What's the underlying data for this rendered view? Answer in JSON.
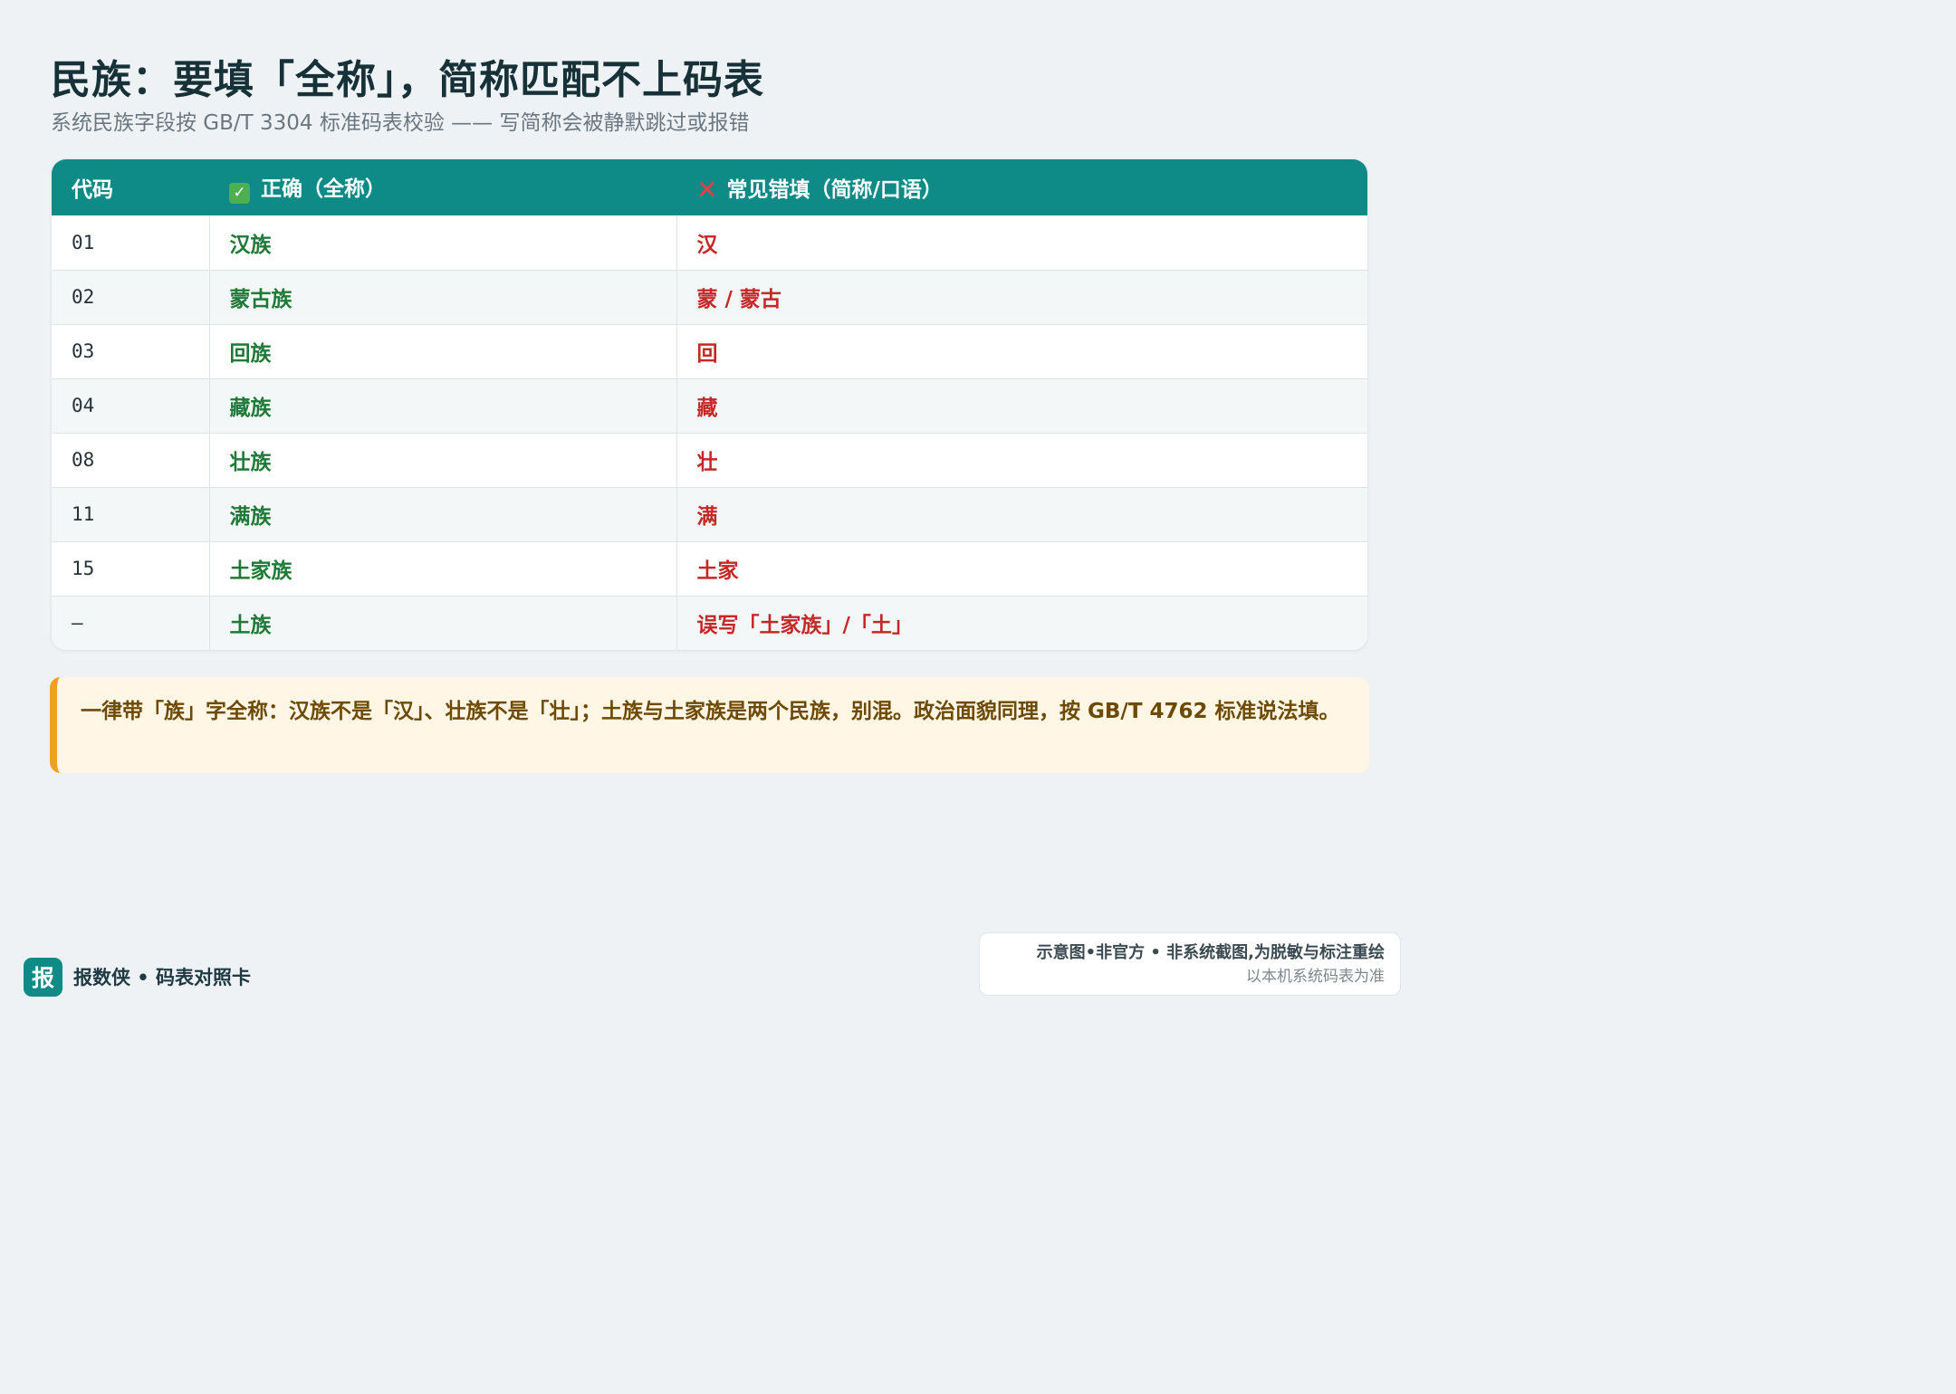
{
  "title": "民族：要填「全称」，简称匹配不上码表",
  "subtitle": "系统民族字段按 GB/T 3304 标准码表校验 —— 写简称会被静默跳过或报错",
  "table": {
    "headers": {
      "code": "代码",
      "correct": "正确（全称）",
      "correct_icon": "✓",
      "wrong": "常见错填（简称/口语）",
      "wrong_icon": "✕"
    },
    "rows": [
      {
        "code": "01",
        "correct": "汉族",
        "wrong": "汉"
      },
      {
        "code": "02",
        "correct": "蒙古族",
        "wrong": "蒙 / 蒙古"
      },
      {
        "code": "03",
        "correct": "回族",
        "wrong": "回"
      },
      {
        "code": "04",
        "correct": "藏族",
        "wrong": "藏"
      },
      {
        "code": "08",
        "correct": "壮族",
        "wrong": "壮"
      },
      {
        "code": "11",
        "correct": "满族",
        "wrong": "满"
      },
      {
        "code": "15",
        "correct": "土家族",
        "wrong": "土家"
      },
      {
        "code": "—",
        "correct": "土族",
        "wrong": "误写「土家族」/「土」"
      }
    ]
  },
  "note": "一律带「族」字全称：汉族不是「汉」、壮族不是「壮」；土族与土家族是两个民族，别混。政治面貌同理，按 GB/T 4762 标准说法填。",
  "footer": {
    "logo_char": "报",
    "brand": "报数侠 • 码表对照卡",
    "disclaimer_main": "示意图•非官方 • 非系统截图,为脱敏与标注重绘",
    "disclaimer_sub": "以本机系统码表为准"
  },
  "colors": {
    "accent": "#0f8b87",
    "correct": "#1e7a36",
    "wrong": "#c62828",
    "note_border": "#f0a020"
  }
}
